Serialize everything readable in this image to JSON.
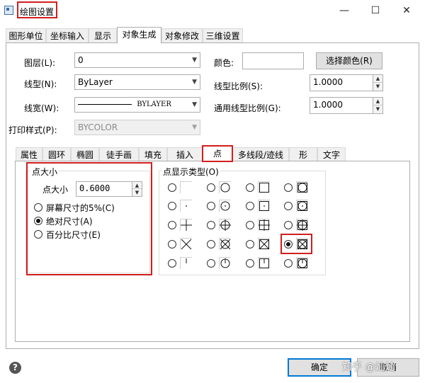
{
  "window": {
    "title": "绘图设置",
    "minimize": "—",
    "maximize": "☐",
    "close": "✕"
  },
  "main_tabs": [
    "图形单位",
    "坐标输入",
    "显示",
    "对象生成",
    "对象修改",
    "三维设置"
  ],
  "main_active_tab": "对象生成",
  "fields": {
    "layer_label": "图层(L):",
    "layer_value": "0",
    "linetype_label": "线型(N):",
    "linetype_value": "ByLayer",
    "lineweight_label": "线宽(W):",
    "lineweight_value": "BYLAYER",
    "plotstyle_label": "打印样式(P):",
    "plotstyle_value": "BYCOLOR",
    "color_label": "颜色:",
    "color_value": "",
    "select_color_button": "选择颜色(R)",
    "ltscale_label": "线型比例(S):",
    "ltscale_value": "1.0000",
    "global_ltscale_label": "通用线型比例(G):",
    "global_ltscale_value": "1.0000"
  },
  "sub_tabs": [
    "属性",
    "圆环",
    "椭圆",
    "徒手画",
    "填充",
    "插入",
    "点",
    "多线段/迹线",
    "形",
    "文字"
  ],
  "sub_active_tab": "点",
  "point_size": {
    "group_title": "点大小",
    "size_label": "点大小",
    "size_value": "0.6000",
    "options": [
      {
        "label": "屏幕尺寸的5%(C)",
        "selected": false
      },
      {
        "label": "绝对尺寸(A)",
        "selected": true
      },
      {
        "label": "百分比尺寸(E)",
        "selected": false
      }
    ]
  },
  "point_display": {
    "group_title": "点显示类型(O)",
    "selected_row": 3,
    "selected_col": 3,
    "styles": [
      [
        "blank",
        "circle",
        "square",
        "circle-square"
      ],
      [
        "dot",
        "dot-circle",
        "dot-square",
        "dot-circle-square"
      ],
      [
        "plus",
        "plus-circle",
        "plus-square",
        "plus-circle-square"
      ],
      [
        "x",
        "x-circle",
        "x-square",
        "x-circle-square"
      ],
      [
        "tick",
        "tick-circle",
        "tick-square",
        "tick-circle-square"
      ]
    ]
  },
  "footer": {
    "ok_button": "确定",
    "cancel_button": "取消",
    "help_icon": "?",
    "watermark": "知乎 @灿灿"
  },
  "colors": {
    "highlight": "#d21e1e",
    "focus": "#0078d7"
  }
}
